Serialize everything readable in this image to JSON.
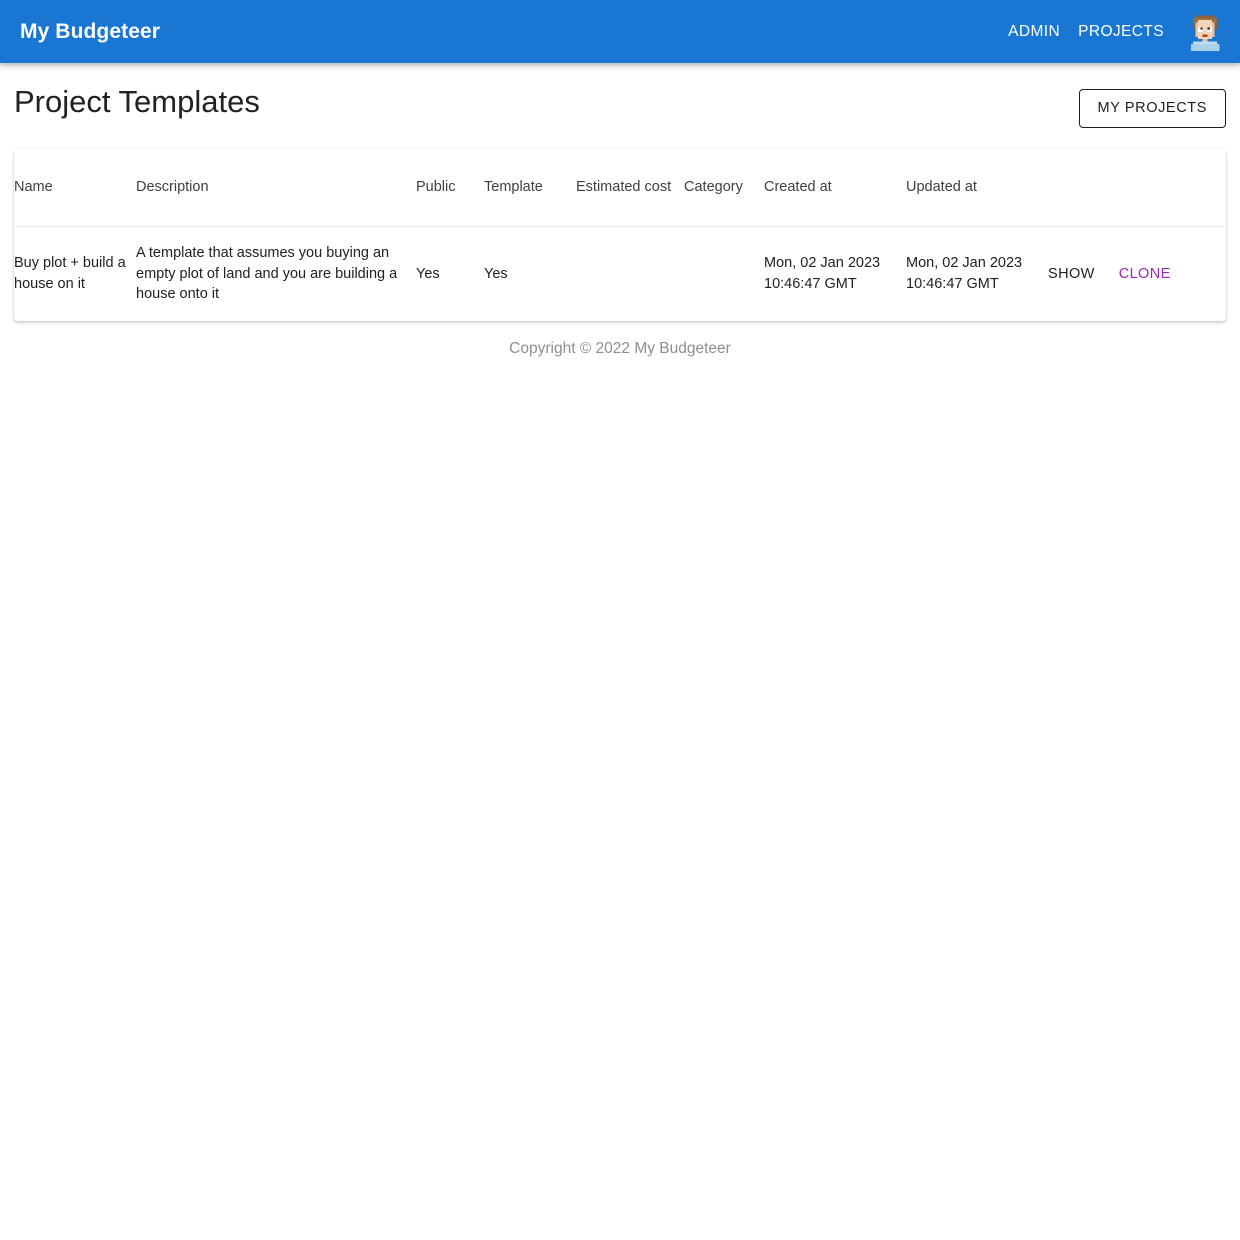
{
  "appbar": {
    "brand": "My Budgeteer",
    "nav": [
      {
        "label": "ADMIN",
        "name": "nav-link-admin"
      },
      {
        "label": "PROJECTS",
        "name": "nav-link-projects"
      }
    ],
    "avatar_icon": "user-avatar-icon"
  },
  "page": {
    "title": "Project Templates",
    "my_projects_button": "MY PROJECTS"
  },
  "table": {
    "columns": [
      "Name",
      "Description",
      "Public",
      "Template",
      "Estimated cost",
      "Category",
      "Created at",
      "Updated at",
      ""
    ],
    "rows": [
      {
        "name": "Buy plot + build a house on it",
        "description": "A template that assumes you buying an empty plot of land and you are building a house onto it",
        "public": "Yes",
        "template": "Yes",
        "estimated_cost": "",
        "category": "",
        "created_at": "Mon, 02 Jan 2023 10:46:47 GMT",
        "updated_at": "Mon, 02 Jan 2023 10:46:47 GMT",
        "actions": {
          "show": "SHOW",
          "clone": "CLONE"
        }
      }
    ]
  },
  "footer": {
    "copyright": "Copyright © 2022 My Budgeteer"
  },
  "colors": {
    "appbar_blue": "#1976d2",
    "clone_link": "#9c27b0",
    "footer_text": "#8a8f94",
    "row_divider": "#e6e6e6"
  }
}
